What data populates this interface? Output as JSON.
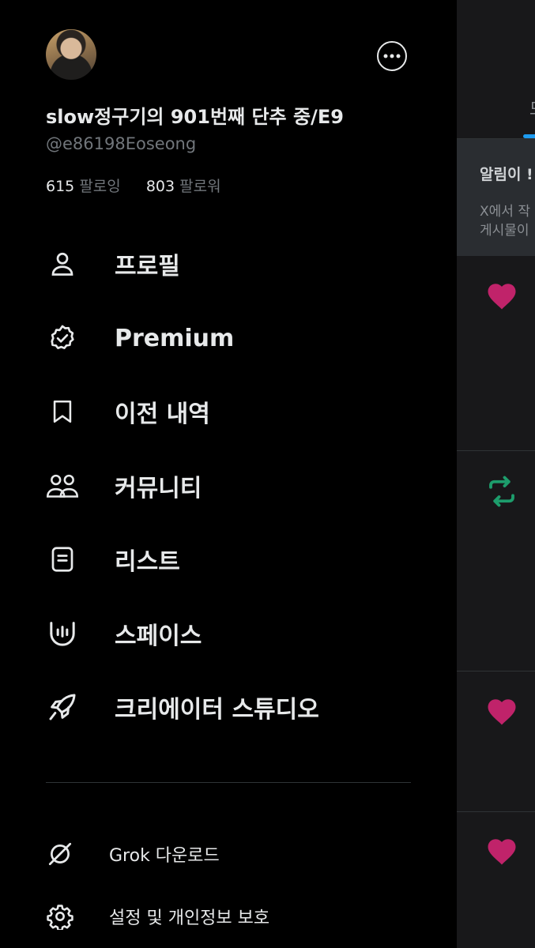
{
  "profile": {
    "display_name": "slow정구기의 901번째 단추 중/E9",
    "handle": "@e86198Eoseong",
    "following_count": "615",
    "following_label": "팔로잉",
    "followers_count": "803",
    "followers_label": "팔로워"
  },
  "menu": [
    {
      "label": "프로필",
      "icon": "person-icon"
    },
    {
      "label": "Premium",
      "icon": "verified-badge-icon"
    },
    {
      "label": "이전 내역",
      "icon": "bookmark-icon"
    },
    {
      "label": "커뮤니티",
      "icon": "communities-icon"
    },
    {
      "label": "리스트",
      "icon": "list-icon"
    },
    {
      "label": "스페이스",
      "icon": "spaces-icon"
    },
    {
      "label": "크리에이터 스튜디오",
      "icon": "rocket-icon"
    }
  ],
  "secondary": [
    {
      "label": "Grok 다운로드",
      "icon": "grok-icon"
    },
    {
      "label": "설정 및 개인정보 보호",
      "icon": "gear-icon"
    }
  ],
  "background": {
    "tab_partial": "모",
    "banner_title_partial": "알림이 !",
    "banner_text_partial_1": "X에서 작",
    "banner_text_partial_2": "게시물이"
  },
  "colors": {
    "like": "#c0236a",
    "repost": "#1d9d6c",
    "accent": "#1d9bf0"
  }
}
